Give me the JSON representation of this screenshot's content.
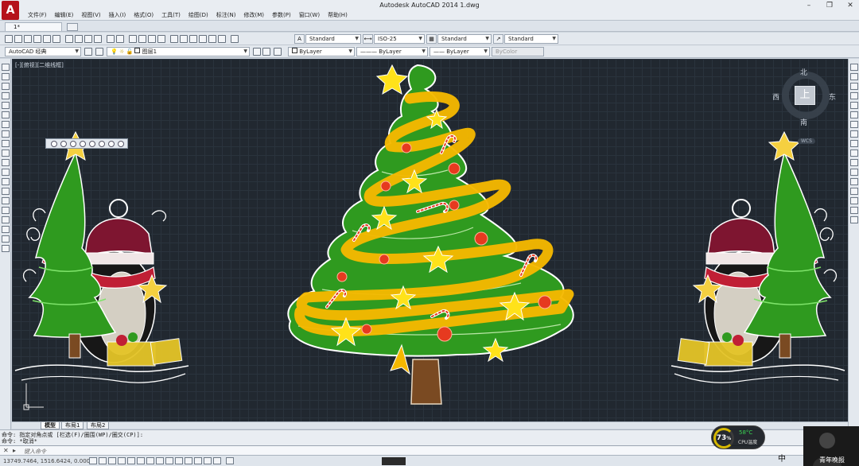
{
  "window": {
    "title": "Autodesk AutoCAD 2014    1.dwg",
    "app_logo": "A",
    "minimize_glyph": "–",
    "restore_glyph": "❐",
    "close_glyph": "✕"
  },
  "menu": [
    "文件(F)",
    "编辑(E)",
    "视图(V)",
    "插入(I)",
    "格式(O)",
    "工具(T)",
    "绘图(D)",
    "标注(N)",
    "修改(M)",
    "参数(P)",
    "窗口(W)",
    "帮助(H)"
  ],
  "tabs": {
    "doc_tab_label": "1*"
  },
  "toolbar_styles": {
    "text_style": "Standard",
    "dim_style": "ISO-25",
    "table_style": "Standard",
    "multileader_style": "Standard"
  },
  "toolbar_layers": {
    "workspace": "AutoCAD 经典",
    "layer": "图层1",
    "color": "ByLayer",
    "linetype": "ByLayer",
    "lineweight": "ByLayer",
    "plotstyle": "ByColor"
  },
  "viewport": {
    "label": "[-][俯视][二维线框]"
  },
  "viewcube": {
    "north": "北",
    "south": "南",
    "west": "西",
    "east": "东",
    "face": "上",
    "wcs": "WCS"
  },
  "layout_tabs": [
    "模型",
    "布局1",
    "布局2"
  ],
  "command": {
    "line1": "命令: 指定对角点或 [栏选(F)/圈围(WP)/圈交(CP)]:",
    "line2": "命令: *取消*",
    "prompt": "键入命令"
  },
  "status": {
    "coordinates": "13749.7464, 1516.6424, 0.0000"
  },
  "system_widget": {
    "cpu_percent": "73",
    "cpu_percent_suffix": "%",
    "temperature": "58°C",
    "cpu_label": "CPU温度"
  },
  "ime": {
    "label": "中"
  },
  "watermark": {
    "text": "青年晚报"
  },
  "colors": {
    "canvas_bg": "#212830",
    "tree_green": "#2f9a1f",
    "ribbon_yellow": "#f5b800",
    "star_yellow": "#ffe21a",
    "ornament_red": "#e63a1f",
    "trunk_brown": "#7a4a22"
  }
}
